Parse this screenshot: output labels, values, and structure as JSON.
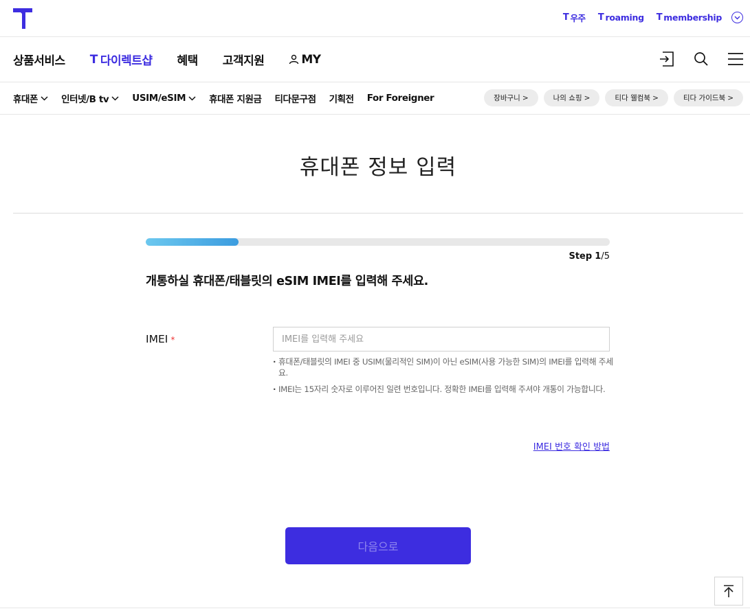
{
  "header": {
    "util_links": [
      {
        "mark": "T",
        "label": "우주"
      },
      {
        "mark": "T",
        "label": "roaming"
      },
      {
        "mark": "T",
        "label": "membership"
      }
    ]
  },
  "gnb": {
    "items": [
      {
        "label": "상품서비스"
      },
      {
        "mark": "T",
        "label": "다이렉트샵"
      },
      {
        "label": "혜택"
      },
      {
        "label": "고객지원"
      },
      {
        "label": "MY"
      }
    ]
  },
  "subnav": {
    "items": [
      {
        "label": "휴대폰"
      },
      {
        "label": "인터넷/B tv"
      },
      {
        "label": "USIM/eSIM"
      },
      {
        "label": "휴대폰 지원금"
      },
      {
        "label": "티다문구점"
      },
      {
        "label": "기획전"
      },
      {
        "label": "For Foreigner"
      }
    ],
    "chips": [
      {
        "label": "장바구니"
      },
      {
        "label": "나의 쇼핑"
      },
      {
        "label": "티다 웰컴북"
      },
      {
        "label": "티다 가이드북"
      }
    ],
    "chip_arrow": ">"
  },
  "content": {
    "title": "휴대폰 정보 입력",
    "progress": 0.2,
    "step_label": "Step",
    "step_current": "1",
    "step_total": "/5",
    "question": "개통하실 휴대폰/태블릿의 eSIM IMEI를 입력해 주세요.",
    "imei_label": "IMEI",
    "required_mark": "*",
    "imei_value": "",
    "imei_placeholder": "IMEI를 입력해 주세요",
    "notes": [
      "휴대폰/태블릿의 IMEI 중 USIM(물리적인 SIM)이 아닌 eSIM(사용 가능한 SIM)의 IMEI를 입력해 주세요.",
      "IMEI는 15자리 숫자로 이루어진 일련 번호입니다. 정확한 IMEI를 입력해 주셔야 개통이 가능합니다."
    ],
    "imei_help_link": "IMEI 번호 확인 방법",
    "next_button": "다음으로"
  },
  "colors": {
    "brand": "#3d2de0",
    "progress_start": "#6cc8ef",
    "progress_end": "#3c9cdf",
    "required": "#ee3333"
  },
  "icons": {
    "logo": "t-logo",
    "util_toggle": "chevron-down-circle-icon",
    "gnb": [
      "login-icon",
      "search-icon",
      "menu-icon"
    ],
    "my": "person-icon",
    "top": "arrow-up-to-top-icon"
  }
}
